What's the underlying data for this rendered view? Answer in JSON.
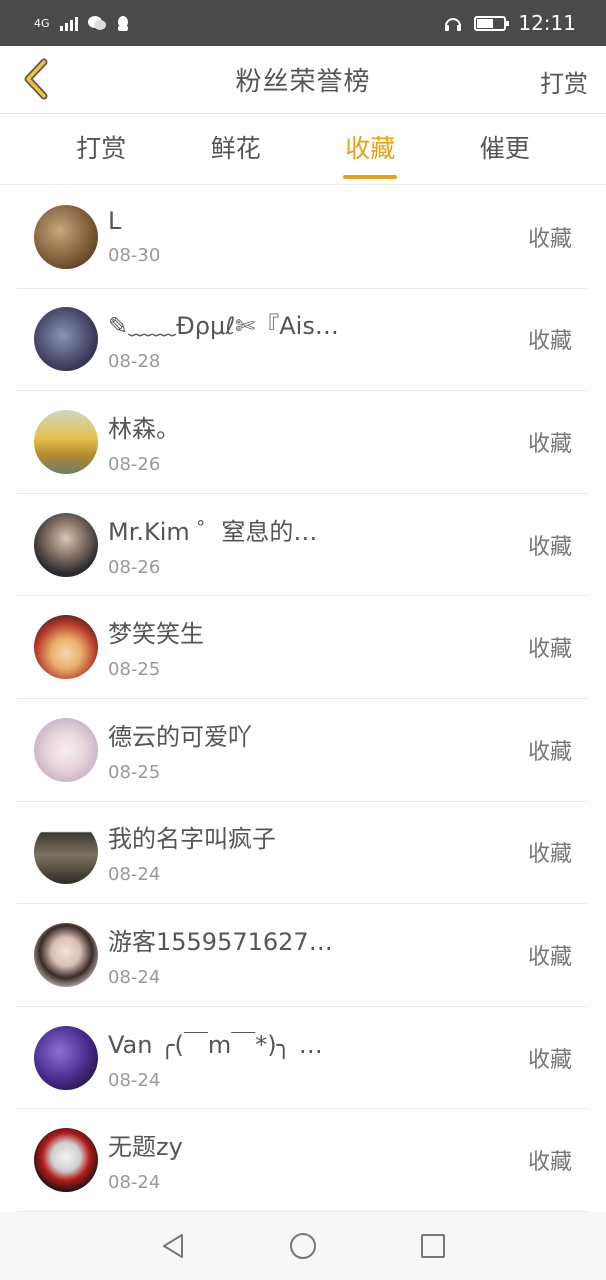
{
  "status_bar": {
    "network": "4G",
    "time": "12:11",
    "battery_level": 0.6
  },
  "header": {
    "title": "粉丝荣誉榜",
    "right_action": "打赏",
    "back_icon": "chevron-left-icon",
    "accent_color": "#e8a215"
  },
  "tabs": [
    {
      "label": "打赏",
      "active": false
    },
    {
      "label": "鲜花",
      "active": false
    },
    {
      "label": "收藏",
      "active": true
    },
    {
      "label": "催更",
      "active": false
    }
  ],
  "fans": [
    {
      "name": "L",
      "date": "08-30",
      "action": "收藏"
    },
    {
      "name": "✎﹏﹏Ɖρμℓ✄『Ais…",
      "date": "08-28",
      "action": "收藏"
    },
    {
      "name": "林森。",
      "date": "08-26",
      "action": "收藏"
    },
    {
      "name": "Mr.Kim ゜窒息的…",
      "date": "08-26",
      "action": "收藏"
    },
    {
      "name": "梦笑笑生",
      "date": "08-25",
      "action": "收藏"
    },
    {
      "name": "德云的可爱吖",
      "date": "08-25",
      "action": "收藏"
    },
    {
      "name": "我的名字叫疯子",
      "date": "08-24",
      "action": "收藏"
    },
    {
      "name": "游客1559571627…",
      "date": "08-24",
      "action": "收藏"
    },
    {
      "name": "Van ╭(￣m￣*)╮ …",
      "date": "08-24",
      "action": "收藏"
    },
    {
      "name": "无题zy",
      "date": "08-24",
      "action": "收藏"
    }
  ],
  "nav": {
    "back_icon": "triangle-back-icon",
    "home_icon": "circle-home-icon",
    "recent_icon": "square-recent-icon"
  }
}
